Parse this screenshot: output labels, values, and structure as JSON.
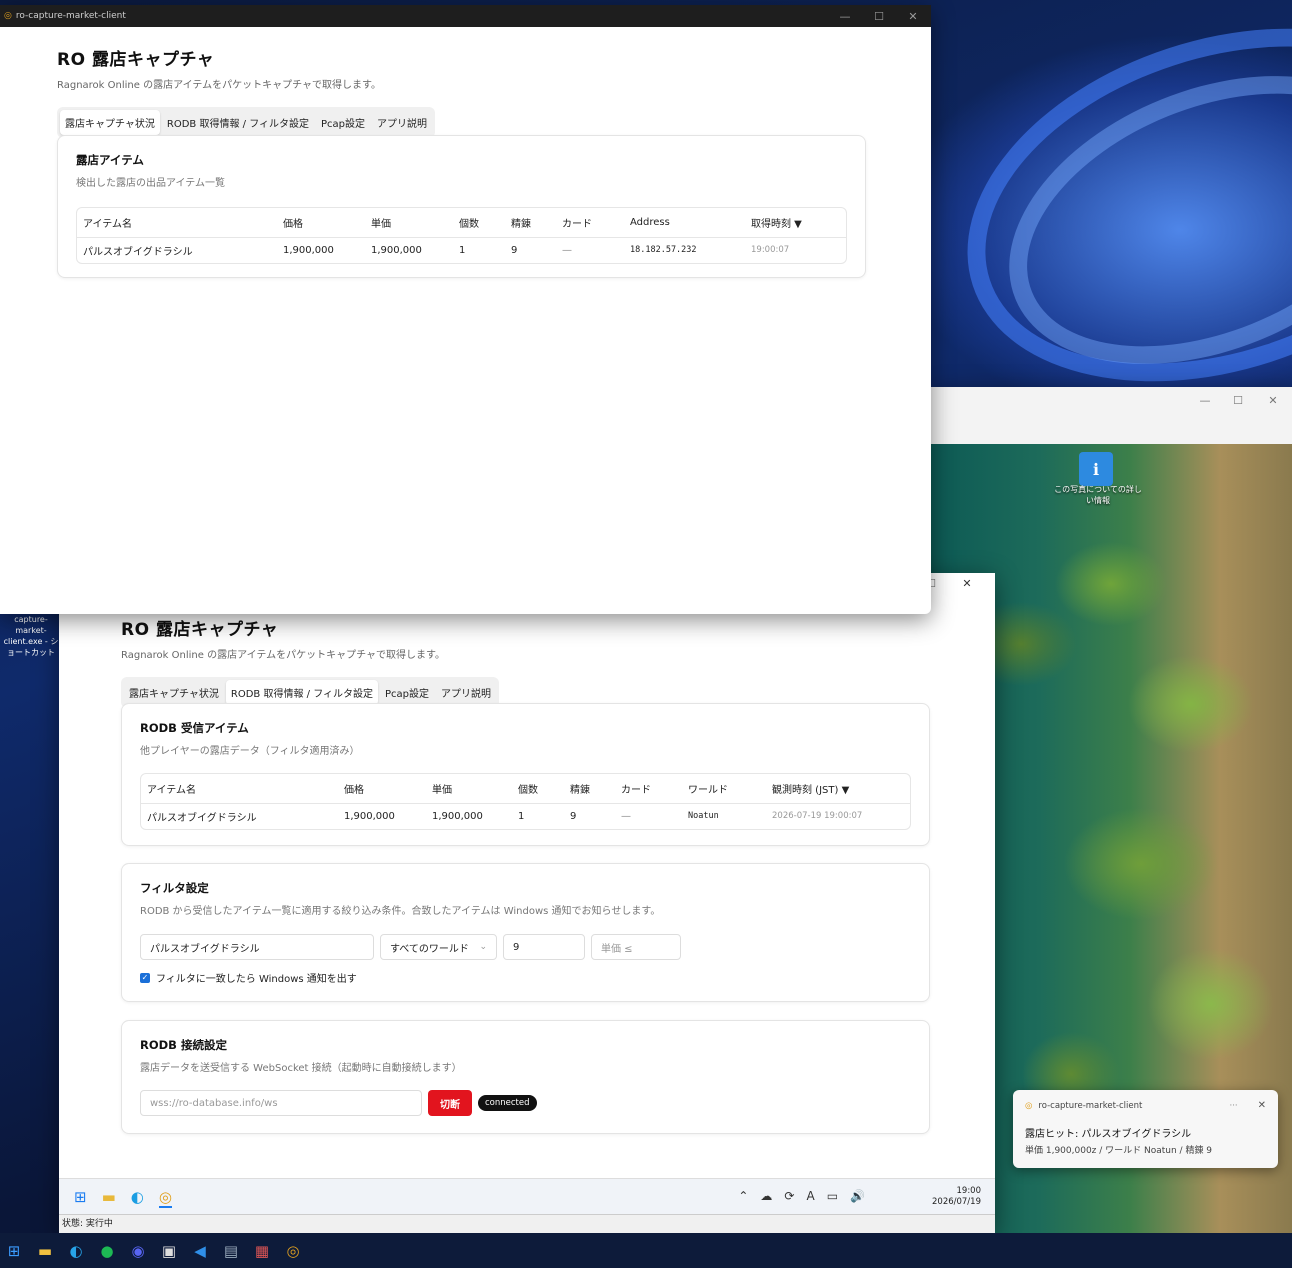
{
  "front_window": {
    "title": "ro-capture-market-client",
    "app_title": "RO 露店キャプチャ",
    "subtitle": "Ragnarok Online の露店アイテムをパケットキャプチャで取得します。",
    "tabs": [
      "露店キャプチャ状況",
      "RODB 取得情報 / フィルタ設定",
      "Pcap設定",
      "アプリ説明"
    ],
    "active_tab": 0,
    "card": {
      "title": "露店アイテム",
      "desc": "検出した露店の出品アイテム一覧",
      "columns": [
        "アイテム名",
        "価格",
        "単価",
        "個数",
        "精錬",
        "カード",
        "Address",
        "取得時刻 ▼"
      ],
      "rows": [
        {
          "name": "パルスオブイグドラシル",
          "price": "1,900,000",
          "unit": "1,900,000",
          "qty": "1",
          "refine": "9",
          "card": "—",
          "address": "18.182.57.232",
          "time": "19:00:07"
        }
      ]
    }
  },
  "back_window": {
    "app_title": "RO 露店キャプチャ",
    "subtitle": "Ragnarok Online の露店アイテムをパケットキャプチャで取得します。",
    "tabs": [
      "露店キャプチャ状況",
      "RODB 取得情報 / フィルタ設定",
      "Pcap設定",
      "アプリ説明"
    ],
    "active_tab": 1,
    "rodb": {
      "title": "RODB 受信アイテム",
      "desc": "他プレイヤーの露店データ（フィルタ適用済み）",
      "columns": [
        "アイテム名",
        "価格",
        "単価",
        "個数",
        "精錬",
        "カード",
        "ワールド",
        "観測時刻 (JST) ▼"
      ],
      "rows": [
        {
          "name": "パルスオブイグドラシル",
          "price": "1,900,000",
          "unit": "1,900,000",
          "qty": "1",
          "refine": "9",
          "card": "—",
          "world": "Noatun",
          "time": "2026-07-19 19:00:07"
        }
      ]
    },
    "filter": {
      "title": "フィルタ設定",
      "desc": "RODB から受信したアイテム一覧に適用する絞り込み条件。合致したアイテムは Windows 通知でお知らせします。",
      "item_value": "パルスオブイグドラシル",
      "world_value": "すべてのワールド",
      "refine_value": "9",
      "unit_placeholder": "単価 ≤",
      "notify_label": "フィルタに一致したら Windows 通知を出す",
      "notify_checked": true
    },
    "connection": {
      "title": "RODB 接続設定",
      "desc": "露店データを送受信する WebSocket 接続（起動時に自動接続します）",
      "url_placeholder": "wss://ro-database.info/ws",
      "disconnect_label": "切断",
      "status_badge": "connected"
    },
    "status_bar": "状態: 実行中",
    "inner_taskbar": {
      "time": "19:00",
      "date": "2026/07/19"
    }
  },
  "desktop": {
    "photo_icon_label": "この写真についての詳しい情報",
    "shortcut_label": "capture-market-client.exe - ショートカット"
  },
  "notification": {
    "app": "ro-capture-market-client",
    "title": "露店ヒット: パルスオブイグドラシル",
    "body": "単価 1,900,000z / ワールド Noatun / 精錬 9"
  },
  "colors": {
    "accent_red": "#e2141e",
    "badge": "#111111",
    "taskbar": "#0d1b3a"
  }
}
